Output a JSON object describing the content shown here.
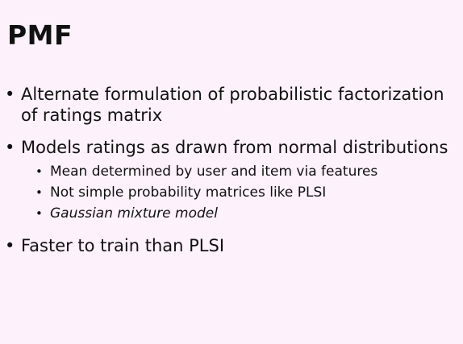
{
  "slide": {
    "title": "PMF",
    "bullets": [
      {
        "text": "Alternate formulation of probabilistic factorization of ratings matrix",
        "sub": []
      },
      {
        "text": "Models ratings as drawn from normal distributions",
        "sub": [
          {
            "text": "Mean determined by user and item via features",
            "italic": false
          },
          {
            "text": "Not simple probability matrices like PLSI",
            "italic": false
          },
          {
            "text": "Gaussian mixture model",
            "italic": true
          }
        ]
      },
      {
        "text": "Faster to train than PLSI",
        "sub": []
      }
    ],
    "bullet_glyph": "•",
    "colors": {
      "background": "#fdf1fb",
      "text": "#111111"
    }
  }
}
